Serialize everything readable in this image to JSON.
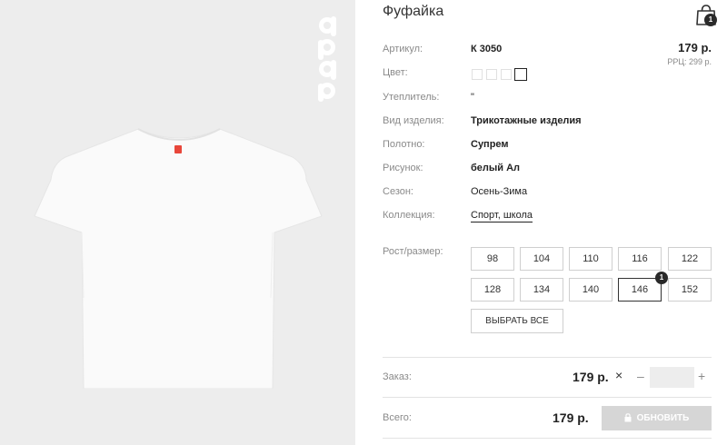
{
  "product": {
    "title": "Фуфайка",
    "cart_count": "1",
    "price": "179 р.",
    "rrp": "РРЦ: 299 р."
  },
  "details": [
    {
      "label": "Артикул:",
      "value": "К 3050"
    },
    {
      "label": "Цвет:",
      "value": ""
    },
    {
      "label": "Утеплитель:",
      "value": "\""
    },
    {
      "label": "Вид изделия:",
      "value": "Трикотажные изделия"
    },
    {
      "label": "Полотно:",
      "value": "Супрем"
    },
    {
      "label": "Рисунок:",
      "value": "белый Ал"
    },
    {
      "label": "Сезон:",
      "value": "Осень-Зима"
    },
    {
      "label": "Коллекция:",
      "value": "Спорт, школа"
    }
  ],
  "sizes": {
    "label": "Рост/размер:",
    "options": [
      "98",
      "104",
      "110",
      "116",
      "122",
      "128",
      "134",
      "140",
      "146",
      "152"
    ],
    "selected": "146",
    "selected_count": "1",
    "select_all_label": "ВЫБРАТЬ ВСЕ"
  },
  "order": {
    "label": "Заказ:",
    "price": "179 р.",
    "remove_symbol": "×",
    "minus": "–",
    "plus": "+",
    "quantity": ""
  },
  "total": {
    "label": "Всего:",
    "price": "179 р.",
    "update_label": "ОБНОВИТЬ"
  },
  "colors": {
    "photo_bg": "#ededed",
    "button_disabled": "#d6d6d6"
  }
}
